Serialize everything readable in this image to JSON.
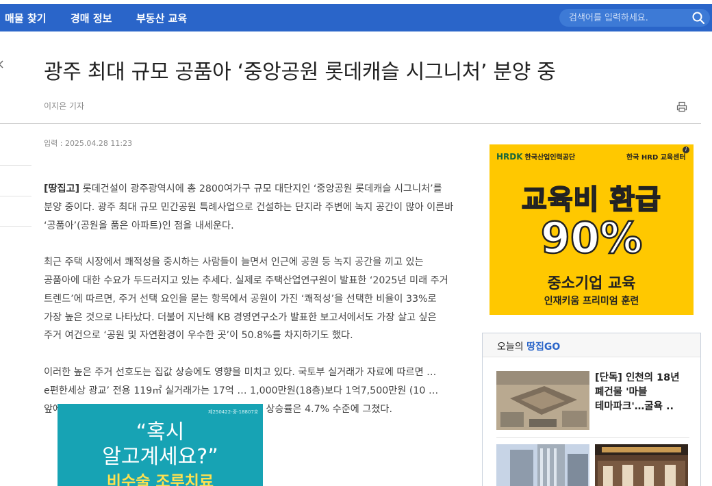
{
  "nav": {
    "items": [
      "매물 찾기",
      "경매 정보",
      "부동산 교육"
    ],
    "search_placeholder": "검색어를 입력하세요."
  },
  "article": {
    "headline": "광주 최대 규모 공품아 ‘중앙공원 롯데캐슬 시그니처’ 분양 중",
    "reporter": "이지은 기자",
    "date": "입력 : 2025.04.28 11:23",
    "tag": "[땅집고]",
    "p1": "롯데건설이 광주광역시에 총 2800여가구 규모 대단지인 ‘중앙공원 롯데캐슬 시그니처’를 분양 중이다. 광주 최대 규모 민간공원 특례사업으로 건설하는 단지라 주변에 녹지 공간이 많아 이른바 ‘공품아’(공원을 품은 아파트)인 점을 내세운다.",
    "p2": "최근 주택 시장에서 쾌적성을 중시하는 사람들이 늘면서 인근에 공원 등 녹지 공간을 끼고 있는 공품아에 대한 수요가 두드러지고 있는 추세다. 실제로 주택산업연구원이 발표한 ‘2025년 미래 주거 트렌드’에 따르면, 주거 선택 요인을 묻는 항목에서 공원이 가진 ‘쾌적성’을 선택한 비율이 33%로 가장 높은 것으로 나타났다. 더불어 지난해 KB 경영연구소가 발표한 보고서에서도 가장 살고 싶은 주거 여건으로 ‘공원 및 자연환경이 우수한 곳’이 50.8%를 차지하기도 했다.",
    "p3": "이러한 높은 주거 선호도는 집값 상승에도 영향을 미치고 있다. 국토부 실거래가 자료에 따르면 … e편한세상 광교’ 전용 119㎡ 실거래가는 17억 … 1,000만원(18층)보다 1억7,500만원 (10 … 앞에 광교중앙공원이 자리한 것이 특징이다. … 매매가 상승률은 4.7% 수준에 그쳤다."
  },
  "ad": {
    "logo_main": "HRDK",
    "logo_sub": "한국산업인력공단",
    "center": "한국 HRD 교육센터",
    "info": "i",
    "line1": "교육비 환급",
    "line2": "90%",
    "line3": "중소기업 교육",
    "line4": "인재키움 프리미엄 훈련"
  },
  "today": {
    "title_prefix": "오늘의 ",
    "title_brand": "땅집GO",
    "news1": "[단독] 인천의 18년 폐건물 '마블 테마파크'…굴욕 .."
  },
  "popup": {
    "code": "제250422-중-18807호",
    "line1": "“혹시",
    "line2": "알고계세요?”",
    "line3": "비수술 조루치료"
  },
  "colors": {
    "nav_bg": "#2a65c9",
    "ad_bg": "#ffc800",
    "popup_bg": "#17a3b4",
    "brand_blue": "#2a65c9"
  }
}
